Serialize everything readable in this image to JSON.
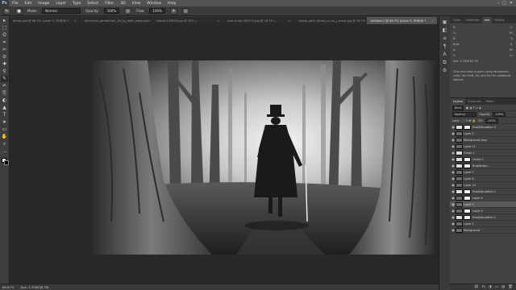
{
  "app": {
    "logo": "Ps"
  },
  "menu": [
    "File",
    "Edit",
    "Image",
    "Layer",
    "Type",
    "Select",
    "Filter",
    "3D",
    "View",
    "Window",
    "Help"
  ],
  "window_controls": [
    "–",
    "□",
    "✕"
  ],
  "options_bar": {
    "mode_label": "Mode:",
    "mode_value": "Normal",
    "opacity_label": "Opacity:",
    "opacity_value": "100%",
    "flow_label": "Flow:",
    "flow_value": "100%"
  },
  "tabs": [
    {
      "label": "forest.psd @ 66.7% (Layer 5, RGB/8) *",
      "active": false
    },
    {
      "label": "attractive_gentleman_16_by_faith_stock.psd @ 66.7% (...",
      "active": false
    },
    {
      "label": "nature-109845.jpg @ 25% (...",
      "active": false
    },
    {
      "label": "tree-trunk-949075.jpg @ 16.7% (...",
      "active": false
    },
    {
      "label": "photo_path_forest_ra_by_j_shoot.jpg @ 16.7% (...",
      "active": false
    },
    {
      "label": "Untitled-1 @ 66.7% (Layer 5, RGB/8) *",
      "active": true
    }
  ],
  "tools": [
    "▸",
    "⬚",
    "ʘ",
    "⌗",
    "✂",
    "⊘",
    "✚",
    "⚲",
    "✎",
    "✍",
    "⎘",
    "◐",
    "▲",
    "T",
    "➤",
    "▭",
    "✋",
    "⌕",
    "…"
  ],
  "panel_strip_icons": [
    "▣",
    "◧",
    "≡",
    "¶",
    "A",
    "⧉",
    "⚙"
  ],
  "info_panel": {
    "tabs": [
      "Color",
      "Swatches",
      "Info",
      "History"
    ],
    "active_tab": "Info",
    "rows": [
      [
        "R:",
        "C:"
      ],
      [
        "G:",
        "M:"
      ],
      [
        "B:",
        "Y:"
      ],
      [
        "8-bit",
        "K:"
      ],
      [
        "X:",
        "W:"
      ],
      [
        "Y:",
        "H:"
      ]
    ],
    "doc_line": "Doc: 2.33M/36.7M",
    "help_text": "Click and drag to paint using foreground color. Use Shift, Alt, and Ctrl for additional options."
  },
  "layers_panel": {
    "tabs": [
      "Layers",
      "Channels",
      "Paths"
    ],
    "active_tab": "Layers",
    "kind_label": "Kind",
    "blend_mode": "Normal",
    "opacity_label": "Opacity:",
    "opacity_value": "100%",
    "lock_label": "Lock:",
    "fill_label": "Fill:",
    "fill_value": "100%",
    "layers": [
      {
        "name": "Hue/Saturation 3",
        "thumb": "light",
        "mask": true,
        "selected": false
      },
      {
        "name": "Layer 2",
        "thumb": "dark",
        "mask": false,
        "selected": false
      },
      {
        "name": "Background copy",
        "thumb": "dark",
        "mask": false,
        "selected": false
      },
      {
        "name": "Layer 11",
        "thumb": "dark",
        "mask": false,
        "selected": false
      },
      {
        "name": "Group 1",
        "thumb": "light",
        "mask": false,
        "selected": false
      },
      {
        "name": "Levels 1",
        "thumb": "light",
        "mask": true,
        "selected": false
      },
      {
        "name": "Brightness...",
        "thumb": "light",
        "mask": true,
        "selected": false
      },
      {
        "name": "Layer 7",
        "thumb": "dark",
        "mask": false,
        "selected": false
      },
      {
        "name": "Layer 6",
        "thumb": "dark",
        "mask": false,
        "selected": false
      },
      {
        "name": "Layer 10",
        "thumb": "dark",
        "mask": false,
        "selected": false
      },
      {
        "name": "Hue/Saturation 2",
        "thumb": "light",
        "mask": true,
        "selected": false
      },
      {
        "name": "Layer 4",
        "thumb": "dark",
        "mask": true,
        "selected": false
      },
      {
        "name": "Layer 5",
        "thumb": "dark",
        "mask": false,
        "selected": true
      },
      {
        "name": "Layer 3",
        "thumb": "dark",
        "mask": true,
        "selected": false
      },
      {
        "name": "Hue/Saturation 1",
        "thumb": "light",
        "mask": true,
        "selected": false
      },
      {
        "name": "Layer 1",
        "thumb": "dark",
        "mask": false,
        "selected": false
      },
      {
        "name": "Background",
        "thumb": "dark",
        "mask": false,
        "selected": false
      }
    ],
    "footer_icons": [
      "⛓",
      "fx",
      "◑",
      "▭",
      "▤",
      "🗑"
    ]
  },
  "status_bar": {
    "zoom": "66.67%",
    "doc_info": "Doc: 2.33M/36.7M"
  }
}
